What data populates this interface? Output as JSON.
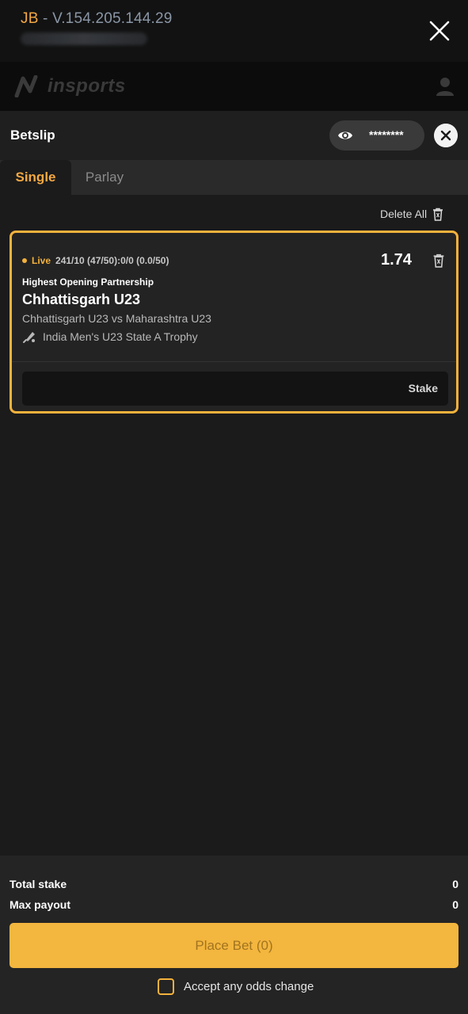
{
  "window": {
    "prefix": "JB",
    "separator": " - ",
    "version": "V.154.205.144.29"
  },
  "brand": {
    "logo_text": "insports"
  },
  "betslip": {
    "title": "Betslip",
    "balance_mask": "********",
    "tabs": [
      {
        "label": "Single",
        "active": true
      },
      {
        "label": "Parlay",
        "active": false
      }
    ],
    "delete_all_label": "Delete All",
    "bet": {
      "live_label": "Live",
      "score": "241/10 (47/50):0/0 (0.0/50)",
      "odds": "1.74",
      "market": "Highest Opening Partnership",
      "selection": "Chhattisgarh U23",
      "match": "Chhattisgarh U23  vs  Maharashtra U23",
      "league": "India Men's U23 State A Trophy",
      "stake_placeholder": "Stake"
    }
  },
  "footer": {
    "total_stake_label": "Total stake",
    "total_stake_value": "0",
    "max_payout_label": "Max payout",
    "max_payout_value": "0",
    "place_bet_label": "Place Bet (0)",
    "accept_odds_label": "Accept any odds change"
  },
  "colors": {
    "accent": "#f3b23c",
    "background": "#1b1b1b"
  }
}
